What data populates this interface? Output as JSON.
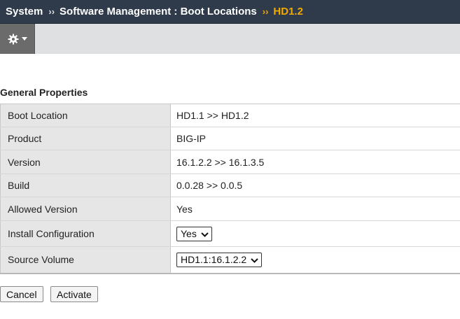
{
  "breadcrumb": {
    "items": [
      "System",
      "Software Management : Boot Locations"
    ],
    "separator": "››",
    "current": "HD1.2"
  },
  "toolbar": {
    "menu_icon": "gear-icon",
    "menu_caret": "caret-down-icon"
  },
  "section": {
    "title": "General Properties"
  },
  "properties": [
    {
      "label": "Boot Location",
      "value": "HD1.1 >> HD1.2"
    },
    {
      "label": "Product",
      "value": "BIG-IP"
    },
    {
      "label": "Version",
      "value": "16.1.2.2 >> 16.1.3.5"
    },
    {
      "label": "Build",
      "value": "0.0.28 >> 0.0.5"
    },
    {
      "label": "Allowed Version",
      "value": "Yes"
    },
    {
      "label": "Install Configuration",
      "value": "Yes"
    },
    {
      "label": "Source Volume",
      "value": "HD1.1:16.1.2.2"
    }
  ],
  "buttons": {
    "cancel": "Cancel",
    "activate": "Activate"
  },
  "colors": {
    "titlebar": "#2f3a4b",
    "accent": "#f2a900",
    "toolbar": "#dfe0e1",
    "label_cell": "#e6e6e6"
  }
}
